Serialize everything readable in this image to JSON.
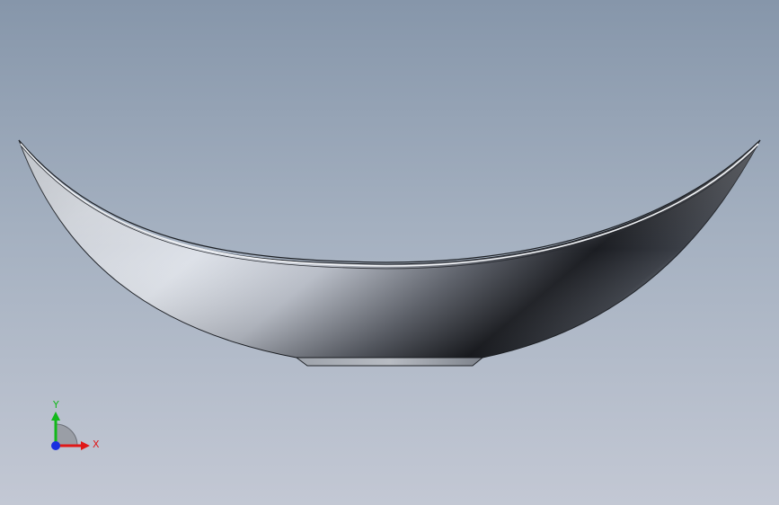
{
  "viewport": {
    "background_top": "#8696aa",
    "background_bottom": "#c3c8d4"
  },
  "model": {
    "part": "boat-shaped-shell",
    "shade_light": "#dfe3ea",
    "shade_dark": "#14171c",
    "edge_color": "#1c1f24"
  },
  "triad": {
    "x_label": "X",
    "y_label": "Y",
    "x_color": "#e01818",
    "y_color": "#12b81a",
    "z_color": "#1a2fe0"
  }
}
